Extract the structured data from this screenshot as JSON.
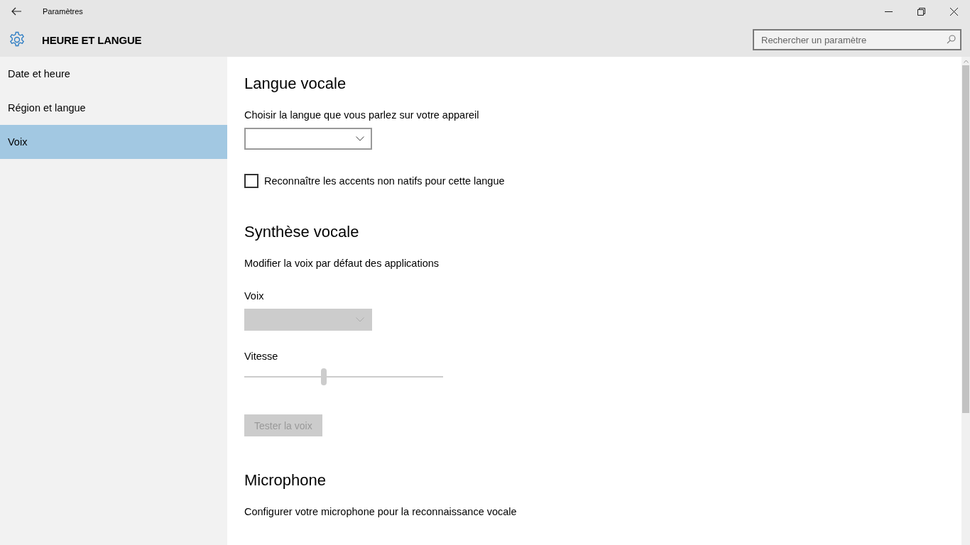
{
  "window": {
    "title": "Paramètres"
  },
  "header": {
    "title": "HEURE ET LANGUE",
    "search": {
      "placeholder": "Rechercher un paramètre"
    }
  },
  "sidebar": {
    "items": [
      {
        "label": "Date et heure",
        "selected": false
      },
      {
        "label": "Région et langue",
        "selected": false
      },
      {
        "label": "Voix",
        "selected": true
      }
    ]
  },
  "content": [
    {
      "kind": "heading",
      "text": "Langue vocale"
    },
    {
      "kind": "text",
      "text": "Choisir la langue que vous parlez sur votre appareil"
    },
    {
      "kind": "dropdown",
      "disabled": false
    },
    {
      "kind": "checkbox",
      "label": "Reconnaître les accents non natifs pour cette langue",
      "checked": false
    },
    {
      "kind": "heading",
      "text": "Synthèse vocale"
    },
    {
      "kind": "text",
      "text": "Modifier la voix par défaut des applications"
    },
    {
      "kind": "label",
      "text": "Voix"
    },
    {
      "kind": "dropdown",
      "disabled": true
    },
    {
      "kind": "label",
      "text": "Vitesse"
    },
    {
      "kind": "slider",
      "level": 0.4,
      "disabled": true
    },
    {
      "kind": "button",
      "label": "Tester la voix",
      "disabled": true
    },
    {
      "kind": "heading",
      "text": "Microphone"
    },
    {
      "kind": "text",
      "text": "Configurer votre microphone pour la reconnaissance vocale"
    }
  ]
}
